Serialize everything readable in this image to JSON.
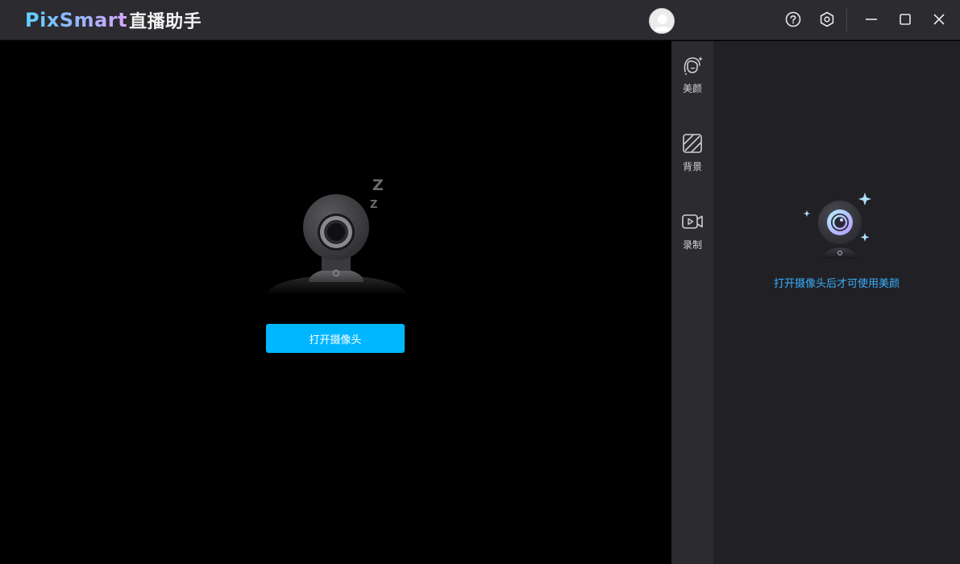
{
  "app": {
    "brand_en": "PixSmart",
    "brand_cn": "直播助手"
  },
  "titlebar": {
    "icons": [
      "user-avatar-icon",
      "help-icon",
      "settings-icon",
      "minimize-icon",
      "maximize-icon",
      "close-icon"
    ]
  },
  "preview": {
    "open_camera_label": "打开摄像头",
    "illustration": "sleeping-webcam-icon"
  },
  "tools": [
    {
      "label": "美颜",
      "icon": "beauty-face-icon"
    },
    {
      "label": "背景",
      "icon": "background-icon"
    },
    {
      "label": "录制",
      "icon": "record-video-icon"
    }
  ],
  "side_panel": {
    "hint": "打开摄像头后才可使用美颜",
    "illustration": "sparkle-webcam-icon"
  },
  "colors": {
    "accent": "#00b7ff",
    "hint": "#3aaeff",
    "titlebar_bg": "#2b2b30",
    "panel_bg": "#212125"
  }
}
